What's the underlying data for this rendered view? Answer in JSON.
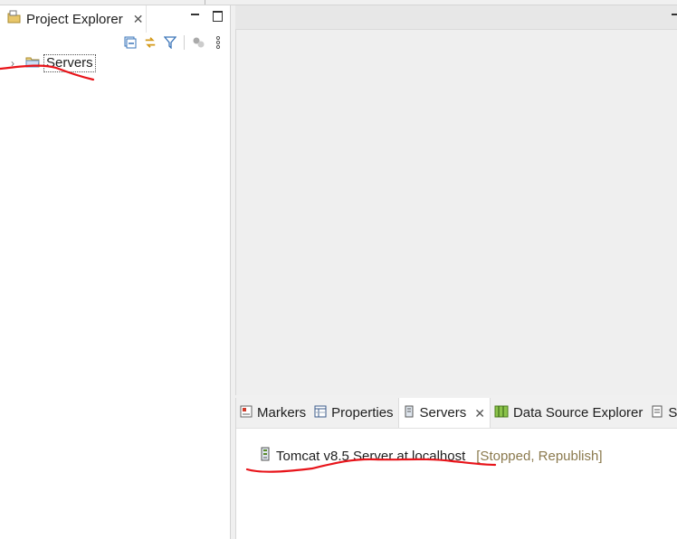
{
  "project_explorer": {
    "title": "Project Explorer",
    "close": "✕",
    "tree": [
      {
        "label": "Servers",
        "expanded": false
      }
    ]
  },
  "toolbar": {
    "icons": [
      "collapse-all-icon",
      "link-with-editor-icon",
      "filter-icon",
      "focus-icon",
      "view-menu-icon"
    ]
  },
  "bottom_panel": {
    "tabs": [
      {
        "label": "Markers",
        "active": false
      },
      {
        "label": "Properties",
        "active": false
      },
      {
        "label": "Servers",
        "active": true,
        "close": "✕"
      },
      {
        "label": "Data Source Explorer",
        "active": false
      },
      {
        "label": "Sr",
        "active": false
      }
    ],
    "servers": [
      {
        "name": "Tomcat v8.5 Server at localhost",
        "status": "[Stopped, Republish]"
      }
    ]
  },
  "colors": {
    "annotation": "#e8141a",
    "status_text": "#8b7a4e",
    "selection_dots": "#555555"
  }
}
